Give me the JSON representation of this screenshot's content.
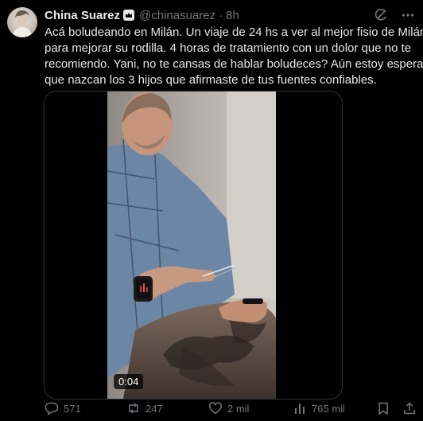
{
  "author": {
    "name": "China Suarez",
    "badge_icon": "crown-badge-icon",
    "handle": "@chinasuarez",
    "separator": "·",
    "time": "8h"
  },
  "header_icons": [
    "grok-icon",
    "more-options-icon"
  ],
  "tweet_text_lines": [
    "Acá boludeando en Milán. Un viaje de 24 hs a ver al mejor fisio de Milán",
    "para mejorar su rodilla. 4 horas de tratamiento con un dolor que no te",
    "recomiendo. Yani, no te cansas de hablar boludeces? Aún estoy esperando",
    "que nazcan los 3 hijos que afirmaste de tus fuentes confiables."
  ],
  "media": {
    "type": "video",
    "timestamp": "0:04"
  },
  "actions": {
    "replies": "571",
    "reposts": "247",
    "likes": "2 mil",
    "views": "765 mil"
  },
  "colors": {
    "background": "#000000",
    "text": "#e7e9ea",
    "secondary": "#71767b",
    "border": "#2f3336"
  }
}
